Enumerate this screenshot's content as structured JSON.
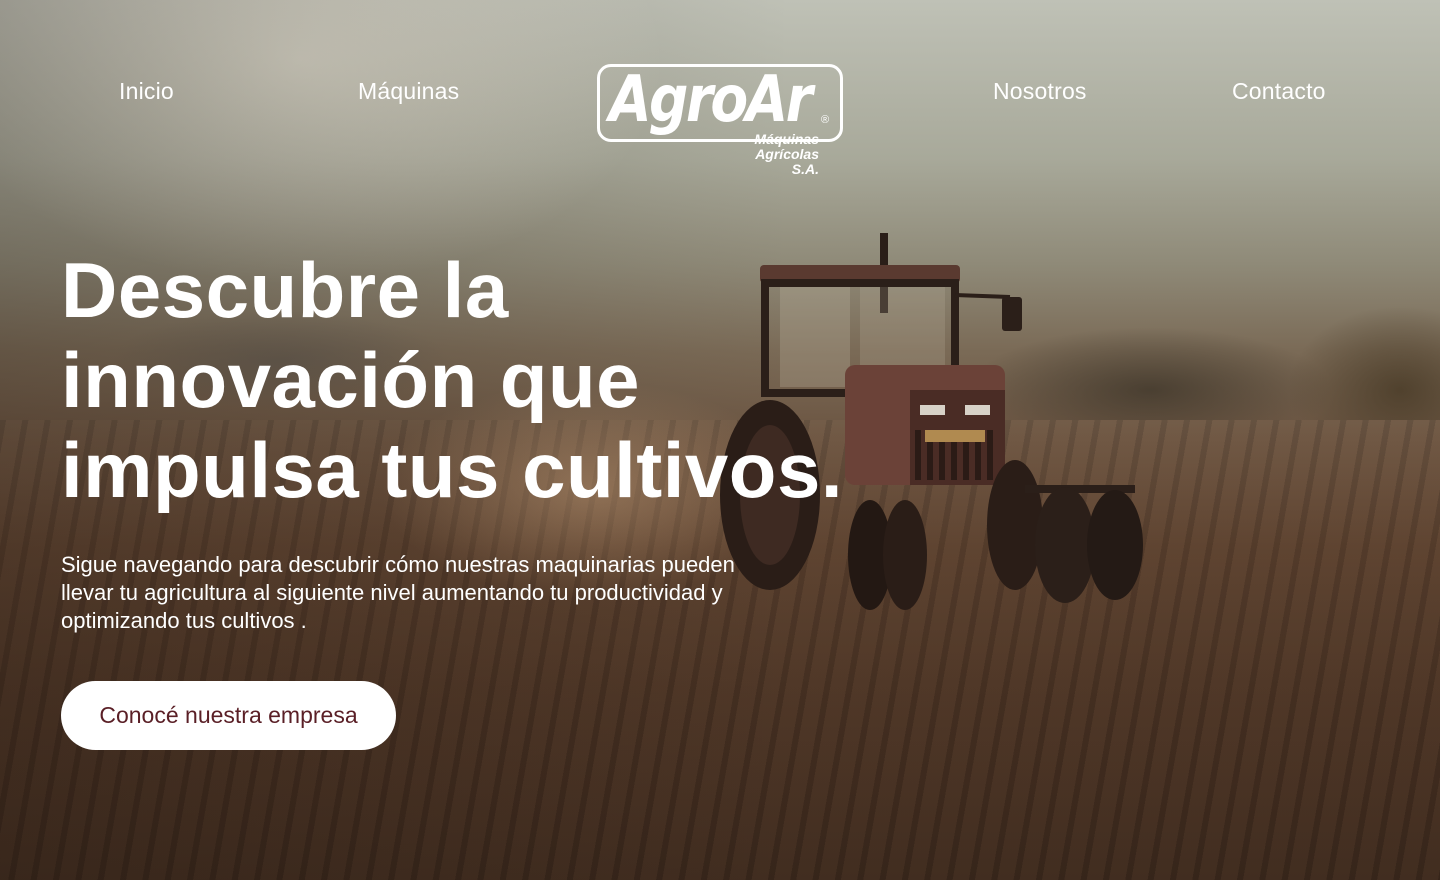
{
  "nav": {
    "links": [
      {
        "label": "Inicio"
      },
      {
        "label": "Máquinas"
      },
      {
        "label": "Nosotros"
      },
      {
        "label": "Contacto"
      }
    ]
  },
  "logo": {
    "name": "AgroAr",
    "registered": "®",
    "tagline_line1": "Máquinas",
    "tagline_line2": "Agrícolas S.A."
  },
  "hero": {
    "title": "Descubre la innovación que impulsa tus cultivos.",
    "subtitle": "Sigue navegando para descubrir cómo nuestras maquinarias pueden llevar tu agricultura al siguiente nivel aumentando tu productividad y optimizando tus cultivos .",
    "cta_label": "Conocé nuestra empresa"
  },
  "colors": {
    "text": "#ffffff",
    "cta_background": "#ffffff",
    "cta_text": "#5a1f26"
  },
  "icons": {
    "background": "tractor-field-image"
  }
}
